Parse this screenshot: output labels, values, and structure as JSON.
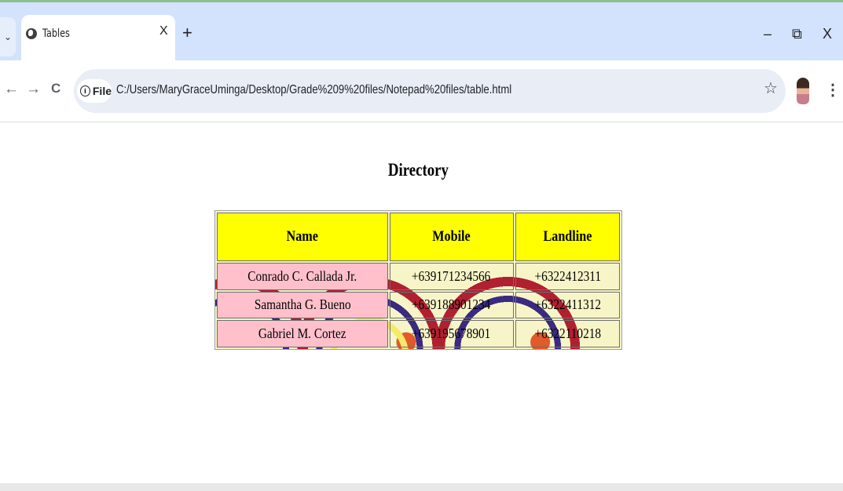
{
  "browser": {
    "tab_title": "Tables",
    "tab_close": "X",
    "new_tab": "+",
    "minimize": "–",
    "restore": "⧉",
    "close": "X",
    "back": "←",
    "forward": "→",
    "reload": "C",
    "site_chip_label": "File",
    "url": "C:/Users/MaryGraceUminga/Desktop/Grade%209%20files/Notepad%20files/table.html",
    "menu": "⋮",
    "bookmark": "☆"
  },
  "page": {
    "title": "Directory",
    "table": {
      "headers": [
        "Name",
        "Mobile",
        "Landline"
      ],
      "rows": [
        {
          "name": "Conrado C. Callada Jr.",
          "mobile": "+639171234566",
          "landline": "+6322412311"
        },
        {
          "name": "Samantha G. Bueno",
          "mobile": "+639188901234",
          "landline": "+6322411312"
        },
        {
          "name": "Gabriel M. Cortez",
          "mobile": "+639195678901",
          "landline": "+6322110218"
        }
      ]
    }
  },
  "colors": {
    "header_bg": "#ffff00",
    "name_bg": "#ffc0cb",
    "tabstrip_bg": "#d3e3fd"
  }
}
